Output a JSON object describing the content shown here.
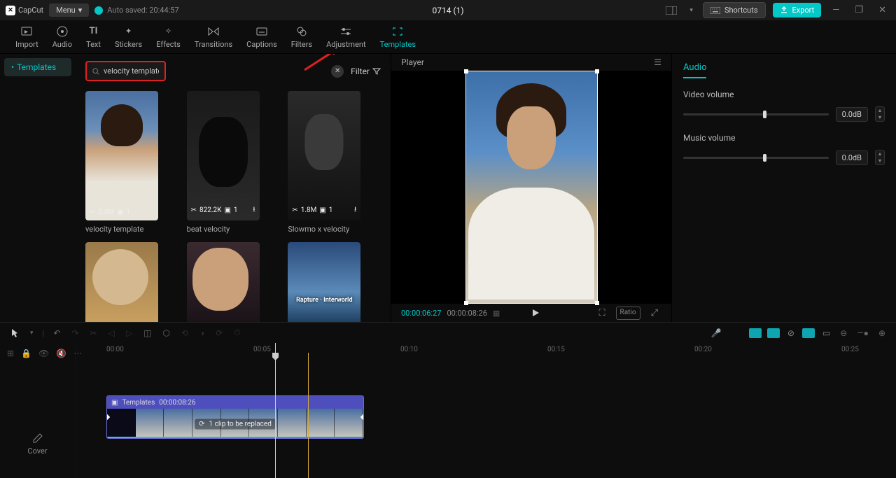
{
  "titlebar": {
    "app": "CapCut",
    "menu": "Menu",
    "autosave": "Auto saved: 20:44:57",
    "project": "0714 (1)",
    "shortcuts": "Shortcuts",
    "export": "Export"
  },
  "tabs": [
    {
      "label": "Import",
      "active": false
    },
    {
      "label": "Audio",
      "active": false
    },
    {
      "label": "Text",
      "active": false
    },
    {
      "label": "Stickers",
      "active": false
    },
    {
      "label": "Effects",
      "active": false
    },
    {
      "label": "Transitions",
      "active": false
    },
    {
      "label": "Captions",
      "active": false
    },
    {
      "label": "Filters",
      "active": false
    },
    {
      "label": "Adjustment",
      "active": false
    },
    {
      "label": "Templates",
      "active": true
    }
  ],
  "sidebar": {
    "templates": "Templates"
  },
  "search": {
    "query": "velocity template",
    "filter": "Filter"
  },
  "templates": [
    {
      "title": "velocity template",
      "uses": "2.0M",
      "clips": "1"
    },
    {
      "title": "beat velocity",
      "uses": "822.2K",
      "clips": "1"
    },
    {
      "title": "Slowmo x velocity",
      "uses": "1.8M",
      "clips": "1"
    }
  ],
  "templates_row2_overlay": "Rapture · Interworld",
  "player": {
    "label": "Player",
    "current": "00:00:06:27",
    "duration": "00:00:08:26",
    "ratio": "Ratio"
  },
  "audio": {
    "title": "Audio",
    "video_label": "Video volume",
    "video_db": "0.0dB",
    "music_label": "Music volume",
    "music_db": "0.0dB"
  },
  "timeline": {
    "marks": [
      "00:00",
      "00:05",
      "00:10",
      "00:15",
      "00:20",
      "00:25"
    ],
    "cover": "Cover",
    "clip_label": "Templates",
    "clip_dur": "00:00:08:26",
    "clip_overlay": "1 clip to be replaced"
  }
}
